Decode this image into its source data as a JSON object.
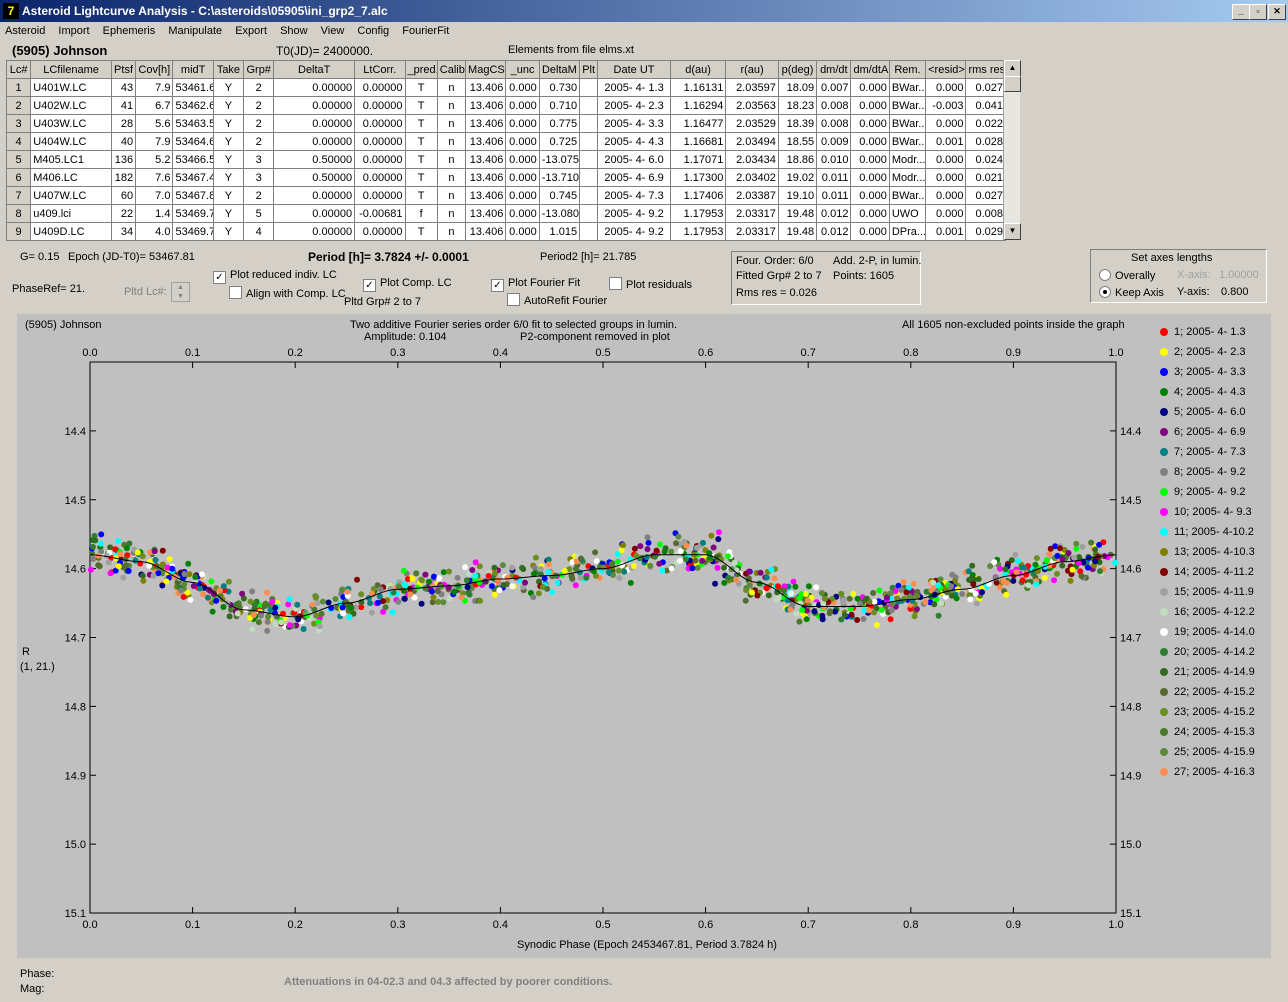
{
  "window": {
    "title": "Asteroid Lightcurve Analysis - C:\\asteroids\\05905\\ini_grp2_7.alc",
    "icon": "7"
  },
  "menu": [
    "Asteroid",
    "Import",
    "Ephemeris",
    "Manipulate",
    "Export",
    "Show",
    "View",
    "Config",
    "FourierFit"
  ],
  "header": {
    "object": "(5905) Johnson",
    "t0": "T0(JD)= 2400000.",
    "elements": "Elements from file elms.xt"
  },
  "table": {
    "columns": [
      "Lc#",
      "LCfilename",
      "Ptsf",
      "Cov[h]",
      "midT",
      "Take",
      "Grp#",
      "DeltaT",
      "LtCorr.",
      "_pred.",
      "Calib.",
      "MagCS",
      "_unc",
      "DeltaM",
      "Plt",
      "Date UT",
      "d(au)",
      "r(au)",
      "p(deg)",
      "dm/dt",
      "dm/dtA",
      "Rem.",
      "<resid>",
      "rms res"
    ],
    "rows": [
      [
        "1",
        "U401W.LC",
        "43",
        "7.9",
        "53461.6",
        "Y",
        "2",
        "0.00000",
        "0.00000",
        "T",
        "n",
        "13.406",
        "0.000",
        "0.730",
        "",
        "2005- 4- 1.3",
        "1.16131",
        "2.03597",
        "18.09",
        "0.007",
        "0.000",
        "BWar..",
        "0.000",
        "0.027"
      ],
      [
        "2",
        "U402W.LC",
        "41",
        "6.7",
        "53462.6",
        "Y",
        "2",
        "0.00000",
        "0.00000",
        "T",
        "n",
        "13.406",
        "0.000",
        "0.710",
        "",
        "2005- 4- 2.3",
        "1.16294",
        "2.03563",
        "18.23",
        "0.008",
        "0.000",
        "BWar..",
        "-0.003",
        "0.041"
      ],
      [
        "3",
        "U403W.LC",
        "28",
        "5.6",
        "53463.5",
        "Y",
        "2",
        "0.00000",
        "0.00000",
        "T",
        "n",
        "13.406",
        "0.000",
        "0.775",
        "",
        "2005- 4- 3.3",
        "1.16477",
        "2.03529",
        "18.39",
        "0.008",
        "0.000",
        "BWar..",
        "0.000",
        "0.022"
      ],
      [
        "4",
        "U404W.LC",
        "40",
        "7.9",
        "53464.6",
        "Y",
        "2",
        "0.00000",
        "0.00000",
        "T",
        "n",
        "13.406",
        "0.000",
        "0.725",
        "",
        "2005- 4- 4.3",
        "1.16681",
        "2.03494",
        "18.55",
        "0.009",
        "0.000",
        "BWar..",
        "0.001",
        "0.028"
      ],
      [
        "5",
        "M405.LC1",
        "136",
        "5.2",
        "53466.5",
        "Y",
        "3",
        "0.50000",
        "0.00000",
        "T",
        "n",
        "13.406",
        "0.000",
        "-13.075",
        "",
        "2005- 4- 6.0",
        "1.17071",
        "2.03434",
        "18.86",
        "0.010",
        "0.000",
        "Modr...",
        "0.000",
        "0.024"
      ],
      [
        "6",
        "M406.LC",
        "182",
        "7.6",
        "53467.4",
        "Y",
        "3",
        "0.50000",
        "0.00000",
        "T",
        "n",
        "13.406",
        "0.000",
        "-13.710",
        "",
        "2005- 4- 6.9",
        "1.17300",
        "2.03402",
        "19.02",
        "0.011",
        "0.000",
        "Modr...",
        "0.000",
        "0.021"
      ],
      [
        "7",
        "U407W.LC",
        "60",
        "7.0",
        "53467.8",
        "Y",
        "2",
        "0.00000",
        "0.00000",
        "T",
        "n",
        "13.406",
        "0.000",
        "0.745",
        "",
        "2005- 4- 7.3",
        "1.17406",
        "2.03387",
        "19.10",
        "0.011",
        "0.000",
        "BWar..",
        "0.000",
        "0.027"
      ],
      [
        "8",
        "u409.lci",
        "22",
        "1.4",
        "53469.7",
        "Y",
        "5",
        "0.00000",
        "-0.00681",
        "f",
        "n",
        "13.406",
        "0.000",
        "-13.080",
        "",
        "2005- 4- 9.2",
        "1.17953",
        "2.03317",
        "19.48",
        "0.012",
        "0.000",
        "UWO",
        "0.000",
        "0.008"
      ],
      [
        "9",
        "U409D.LC",
        "34",
        "4.0",
        "53469.7",
        "Y",
        "4",
        "0.00000",
        "0.00000",
        "T",
        "n",
        "13.406",
        "0.000",
        "1.015",
        "",
        "2005- 4- 9.2",
        "1.17953",
        "2.03317",
        "19.48",
        "0.012",
        "0.000",
        "DPra...",
        "0.001",
        "0.029"
      ]
    ]
  },
  "controls": {
    "g": "G= 0.15",
    "epoch": "Epoch (JD-T0)= 53467.81",
    "period": "Period [h]= 3.7824 +/- 0.0001",
    "period2": "Period2 [h]= 21.785",
    "phaseref": "PhaseRef= 21.",
    "pltd_lc": "Pltd Lc#:",
    "plot_reduced": "Plot reduced indiv. LC",
    "align_comp": "Align with Comp. LC",
    "plot_comp": "Plot Comp. LC",
    "pltd_grp": "Pltd Grp#  2  to  7",
    "plot_fourier": "Plot Fourier Fit",
    "autorefit": "AutoRefit Fourier",
    "plot_residuals": "Plot residuals",
    "four_order": "Four. Order:  6/0",
    "add2p": "Add. 2-P, in lumin.",
    "fitted_grp": "Fitted Grp# 2 to 7",
    "points": "Points: 1605",
    "rms_res": "Rms res     = 0.026",
    "axes_title": "Set axes lengths",
    "overally": "Overally",
    "keep_axis": "Keep Axis",
    "xaxis_label": "X-axis:",
    "xaxis_val": "1.00000",
    "yaxis_label": "Y-axis:",
    "yaxis_val": "0.800"
  },
  "graph": {
    "object": "(5905) Johnson",
    "line1": "Two additive Fourier series order 6/0 fit to selected groups in lumin.",
    "line2_left": "Amplitude: 0.104",
    "line2_right": "P2-component removed in plot",
    "points_note": "All 1605 non-excluded points inside the graph",
    "ylabel": "R",
    "ylabel2": "(1, 21.)",
    "xlabel": "Synodic Phase (Epoch 2453467.81, Period 3.7824 h)",
    "xticks": [
      "0.0",
      "0.1",
      "0.2",
      "0.3",
      "0.4",
      "0.5",
      "0.6",
      "0.7",
      "0.8",
      "0.9",
      "1.0"
    ],
    "yticks": [
      "14.4",
      "14.5",
      "14.6",
      "14.7",
      "14.8",
      "14.9",
      "15.0",
      "15.1"
    ],
    "legend": [
      {
        "label": "1; 2005- 4- 1.3",
        "color": "#ff0000"
      },
      {
        "label": "2; 2005- 4- 2.3",
        "color": "#ffff00"
      },
      {
        "label": "3; 2005- 4- 3.3",
        "color": "#0000ff"
      },
      {
        "label": "4; 2005- 4- 4.3",
        "color": "#008000"
      },
      {
        "label": "5; 2005- 4- 6.0",
        "color": "#000080"
      },
      {
        "label": "6; 2005- 4- 6.9",
        "color": "#800080"
      },
      {
        "label": "7; 2005- 4- 7.3",
        "color": "#008080"
      },
      {
        "label": "8; 2005- 4- 9.2",
        "color": "#808080"
      },
      {
        "label": "9; 2005- 4- 9.2",
        "color": "#00ff00"
      },
      {
        "label": "10; 2005- 4- 9.3",
        "color": "#ff00ff"
      },
      {
        "label": "11; 2005- 4-10.2",
        "color": "#00ffff"
      },
      {
        "label": "13; 2005- 4-10.3",
        "color": "#808000"
      },
      {
        "label": "14; 2005- 4-11.2",
        "color": "#800000"
      },
      {
        "label": "15; 2005- 4-11.9",
        "color": "#a0a0a0"
      },
      {
        "label": "16; 2005- 4-12.2",
        "color": "#c0dcc0"
      },
      {
        "label": "19; 2005- 4-14.0",
        "color": "#ffffff"
      },
      {
        "label": "20; 2005- 4-14.2",
        "color": "#2e7d32"
      },
      {
        "label": "21; 2005- 4-14.9",
        "color": "#33691e"
      },
      {
        "label": "22; 2005- 4-15.2",
        "color": "#556b2f"
      },
      {
        "label": "23; 2005- 4-15.2",
        "color": "#6b8e23"
      },
      {
        "label": "24; 2005- 4-15.3",
        "color": "#4a7a2a"
      },
      {
        "label": "25; 2005- 4-15.9",
        "color": "#5a8a3a"
      },
      {
        "label": "27; 2005- 4-16.3",
        "color": "#ff8c50"
      }
    ]
  },
  "status": {
    "phase": "Phase:",
    "mag": "Mag:",
    "note": "Attenuations in 04-02.3 and 04.3 affected by poorer conditions."
  },
  "chart_data": {
    "type": "scatter",
    "title": "Two additive Fourier series order 6/0 fit to selected groups in lumin.",
    "xlabel": "Synodic Phase (Epoch 2453467.81, Period 3.7824 h)",
    "ylabel": "R",
    "xlim": [
      0.0,
      1.0
    ],
    "ylim": [
      14.3,
      15.1
    ],
    "y_inverted": true,
    "fit_curve": {
      "x": [
        0.0,
        0.05,
        0.1,
        0.15,
        0.2,
        0.25,
        0.3,
        0.35,
        0.4,
        0.45,
        0.5,
        0.55,
        0.6,
        0.65,
        0.7,
        0.75,
        0.8,
        0.85,
        0.9,
        0.95,
        1.0
      ],
      "y": [
        14.58,
        14.59,
        14.62,
        14.66,
        14.67,
        14.65,
        14.63,
        14.625,
        14.615,
        14.61,
        14.6,
        14.58,
        14.58,
        14.62,
        14.655,
        14.655,
        14.645,
        14.63,
        14.61,
        14.59,
        14.58
      ]
    }
  }
}
